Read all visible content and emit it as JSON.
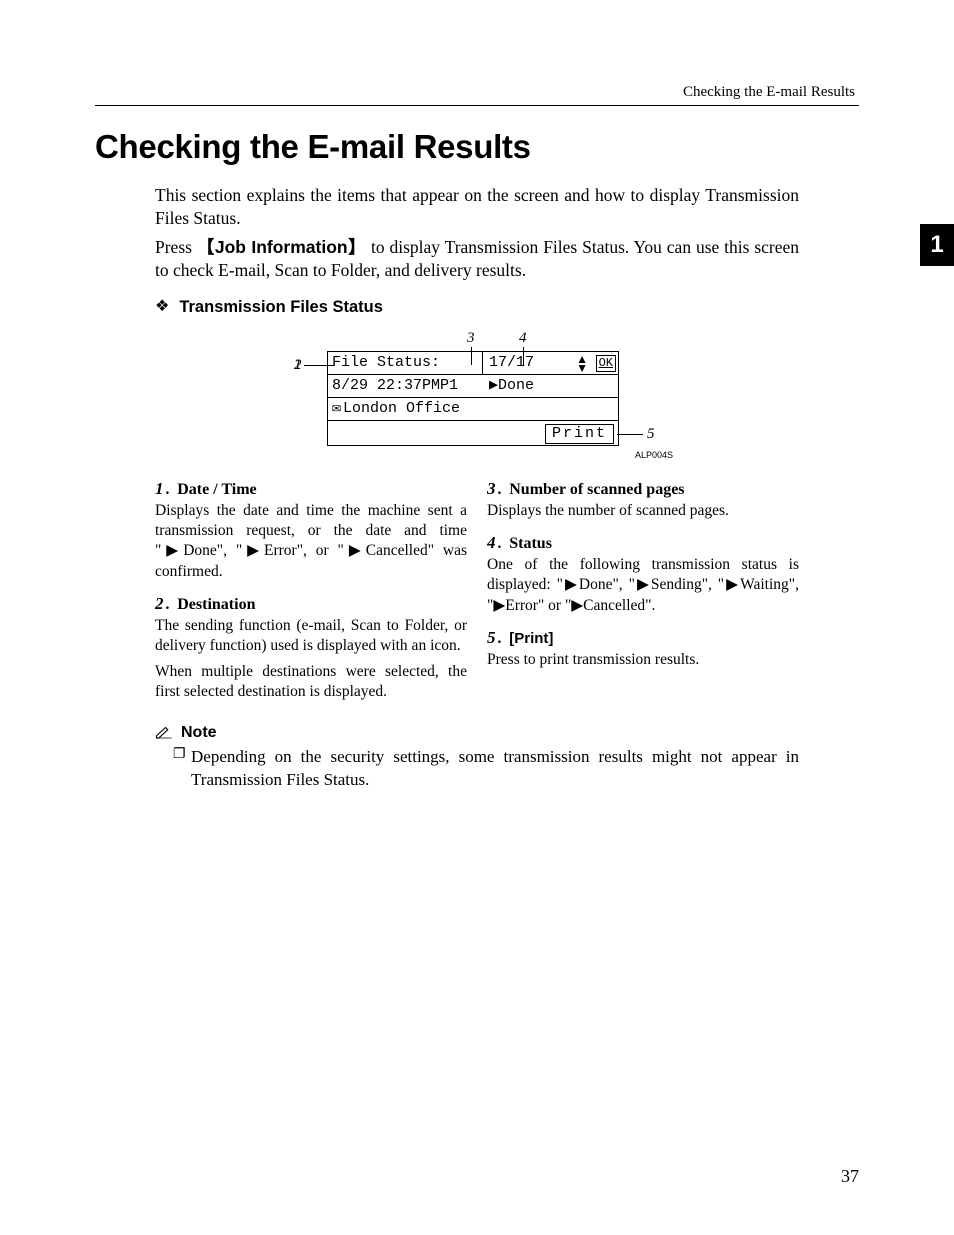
{
  "running_head": "Checking the E-mail Results",
  "title": "Checking the E-mail Results",
  "intro_p1": "This section explains the items that appear on the screen and how to display Transmission Files Status.",
  "intro_p2_pre": "Press ",
  "intro_p2_key": "Job Information",
  "intro_p2_post": " to display Transmission Files Status. You can use this screen to check E-mail, Scan to Folder, and delivery results.",
  "tfs_label": "Transmission Files Status",
  "figure": {
    "callout3": "3",
    "callout4": "4",
    "callout1": "1",
    "callout2": "2",
    "callout5": "5",
    "header_left": "File Status:",
    "header_right": "17/17",
    "ok": "OK",
    "row1_left": "8/29 22:37PMP1",
    "row1_right": "▶Done",
    "row2": "London Office",
    "print": "Print",
    "code": "ALP004S"
  },
  "items_left": [
    {
      "num": "1",
      "name": "Date / Time",
      "body": "Displays the date and time the machine sent a transmission request, or the date and time \"▶Done\", \"▶Error\", or \"▶Cancelled\" was confirmed."
    },
    {
      "num": "2",
      "name": "Destination",
      "body": "The sending function (e-mail, Scan to Folder, or delivery function) used is displayed with an icon.",
      "body2": "When multiple destinations were selected, the first selected destination is displayed."
    }
  ],
  "items_right": [
    {
      "num": "3",
      "name": "Number of scanned pages",
      "body": "Displays the number of scanned pages."
    },
    {
      "num": "4",
      "name": "Status",
      "body": "One of the following transmission status is displayed: \"▶Done\", \"▶Sending\", \"▶Waiting\", \"▶Error\" or \"▶Cancelled\"."
    },
    {
      "num": "5",
      "name": "[Print]",
      "sans": true,
      "body": "Press to print transmission results."
    }
  ],
  "note_label": "Note",
  "note_item": "Depending on the security settings, some transmission results might not appear in Transmission Files Status.",
  "side_tab": "1",
  "page_number": "37"
}
